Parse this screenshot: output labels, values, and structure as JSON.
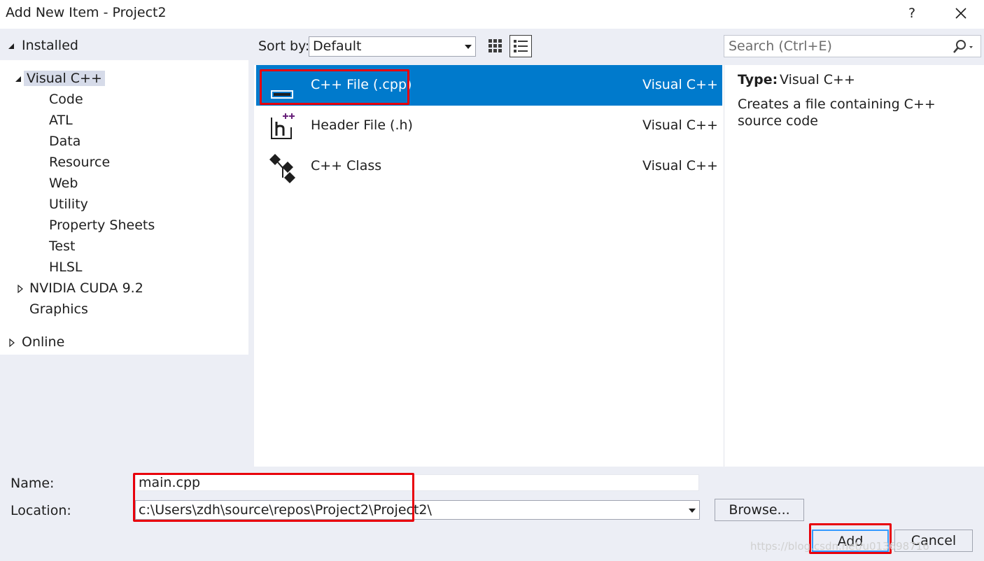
{
  "window": {
    "title": "Add New Item - Project2",
    "help_label": "?",
    "close_icon": "close-icon"
  },
  "left_nav": {
    "installed_label": "Installed",
    "visual_cpp_label": "Visual C++",
    "children": [
      "Code",
      "ATL",
      "Data",
      "Resource",
      "Web",
      "Utility",
      "Property Sheets",
      "Test",
      "HLSL"
    ],
    "nvidia_label": "NVIDIA CUDA 9.2",
    "graphics_label": "Graphics",
    "online_label": "Online"
  },
  "toolbar": {
    "sort_label": "Sort by:",
    "sort_value": "Default",
    "search_placeholder": "Search (Ctrl+E)",
    "view_icons": [
      "grid-view-icon",
      "list-view-icon"
    ]
  },
  "items": [
    {
      "name": "C++ File (.cpp)",
      "type": "Visual C++",
      "icon": "cpp-file-icon",
      "selected": true
    },
    {
      "name": "Header File (.h)",
      "type": "Visual C++",
      "icon": "header-file-icon",
      "selected": false
    },
    {
      "name": "C++ Class",
      "type": "Visual C++",
      "icon": "cpp-class-icon",
      "selected": false
    }
  ],
  "details": {
    "type_label": "Type:",
    "type_value": "Visual C++",
    "description": "Creates a file containing C++ source code"
  },
  "form": {
    "name_label": "Name:",
    "name_value": "main.cpp",
    "location_label": "Location:",
    "location_value": "c:\\Users\\zdh\\source\\repos\\Project2\\Project2\\",
    "browse_label": "Browse...",
    "add_label": "Add",
    "cancel_label": "Cancel"
  },
  "watermark": "https://blog.csdn.net/u013698716",
  "colors": {
    "selection": "#007acc",
    "panel_bg": "#eceef5",
    "highlight_box": "#e8000b"
  }
}
